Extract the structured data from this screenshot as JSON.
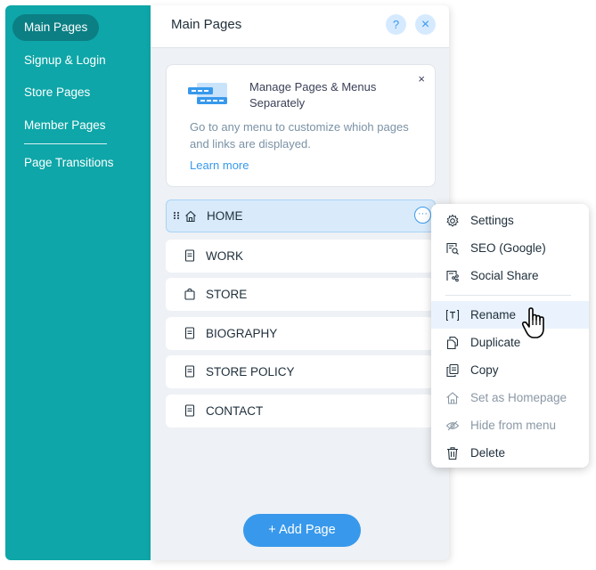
{
  "sidebar": {
    "items": [
      {
        "label": "Main Pages"
      },
      {
        "label": "Signup & Login"
      },
      {
        "label": "Store Pages"
      },
      {
        "label": "Member Pages"
      },
      {
        "label": "Page Transitions"
      }
    ],
    "active_index": 0
  },
  "panel": {
    "title": "Main Pages",
    "help_label": "?",
    "close_label": "×"
  },
  "notice": {
    "title": "Manage Pages & Menus Separately",
    "close_label": "×",
    "body": "Go to any menu to customize whioh pages and links are displayed.",
    "link": "Learn more"
  },
  "pages": [
    {
      "label": "HOME",
      "icon": "home-icon",
      "selected": true
    },
    {
      "label": "WORK",
      "icon": "page-icon"
    },
    {
      "label": "STORE",
      "icon": "shopping-bag-icon"
    },
    {
      "label": "BIOGRAPHY",
      "icon": "page-icon"
    },
    {
      "label": "STORE POLICY",
      "icon": "page-icon"
    },
    {
      "label": "CONTACT",
      "icon": "page-icon"
    }
  ],
  "more_label": "···",
  "add_page_label": "+ Add Page",
  "context_menu": {
    "items": [
      {
        "label": "Settings",
        "icon": "gear-icon"
      },
      {
        "label": "SEO (Google)",
        "icon": "seo-icon"
      },
      {
        "label": "Social Share",
        "icon": "social-share-icon"
      },
      {
        "label": "Rename",
        "icon": "rename-icon",
        "hovered": true
      },
      {
        "label": "Duplicate",
        "icon": "duplicate-icon"
      },
      {
        "label": "Copy",
        "icon": "copy-icon"
      },
      {
        "label": "Set as Homepage",
        "icon": "home-icon",
        "disabled": true
      },
      {
        "label": "Hide from menu",
        "icon": "eye-hidden-icon",
        "disabled": true
      },
      {
        "label": "Delete",
        "icon": "trash-icon"
      }
    ]
  },
  "colors": {
    "sidebar_bg": "#0ea6a8",
    "sidebar_active": "#0b7f84",
    "accent": "#3899ec",
    "selected_row": "#d9ebfb"
  }
}
